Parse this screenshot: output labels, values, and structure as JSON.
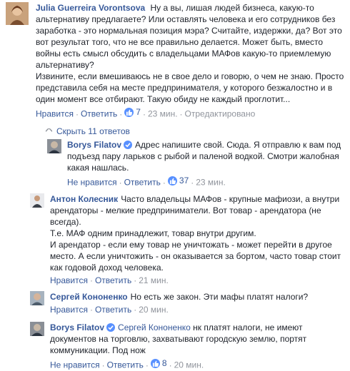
{
  "comments": {
    "main": {
      "author": "Julia Guerreira Vorontsova",
      "text": "Ну а вы, лишая людей бизнеса, какую-то альтернативу предлагаете? Или оставлять человека и его сотрудников без заработка - это нормальная позиция мэра? Считайте, издержки, да? Вот это вот результат того, что не все правильно делается. Может быть, вместо войны есть смысл обсудить с владельцами МАФов какую-то приемлемую альтернативу?",
      "text2": "Извините, если вмешиваюсь не в свое дело и говорю, о чем не знаю. Просто представила себя на месте предпринимателя, у которого безжалостно и в один момент все отбирают. Такую обиду не каждый проглотит...",
      "like_label": "Нравится",
      "reply_label": "Ответить",
      "like_count": "7",
      "time": "23 мин.",
      "edited": "Отредактировано"
    },
    "replies_toggle": "Скрыть 11 ответов",
    "r1": {
      "author": "Borys Filatov",
      "text": "Адрес напишите свой. Сюда. Я отправлю к вам под подъезд пару ларьков с рыбой и паленой водкой. Смотри жалобная какая нашлась.",
      "like_label": "Не нравится",
      "reply_label": "Ответить",
      "like_count": "37",
      "time": "23 мин."
    },
    "r2": {
      "author": "Антон Колесник",
      "text": "Часто владельцы МАФов - крупные мафиози, а внутри арендаторы - мелкие предприниматели. Вот товар - арендатора (не всегда).",
      "text2": "Т.е. МАФ одним принадлежит, товар внутри другим.",
      "text3": "И арендатор - если ему товар не уничтожать - может перейти в другое место. А если уничтожить - он оказывается за бортом, часто товар стоит как годовой доход человека.",
      "like_label": "Нравится",
      "reply_label": "Ответить",
      "time": "21 мин."
    },
    "r3": {
      "author": "Сергей Кононенко",
      "text": "Но есть же закон. Эти мафы платят налоги?",
      "like_label": "Нравится",
      "reply_label": "Ответить",
      "time": "20 мин."
    },
    "r4": {
      "author": "Borys Filatov",
      "mention": "Сергей Кононенко",
      "text": "нк платят налоги, не имеют документов на торговлю, захватывают городскую землю, портят коммуникации. Под нож",
      "like_label": "Не нравится",
      "reply_label": "Ответить",
      "like_count": "8",
      "time": "20 мин."
    }
  },
  "colors": {
    "link": "#365899",
    "meta": "#90949c",
    "like_blue": "#5890ff"
  },
  "icons": {
    "verified": "verified-badge-icon",
    "like": "thumbs-up-icon",
    "collapse": "collapse-arrow-icon"
  }
}
